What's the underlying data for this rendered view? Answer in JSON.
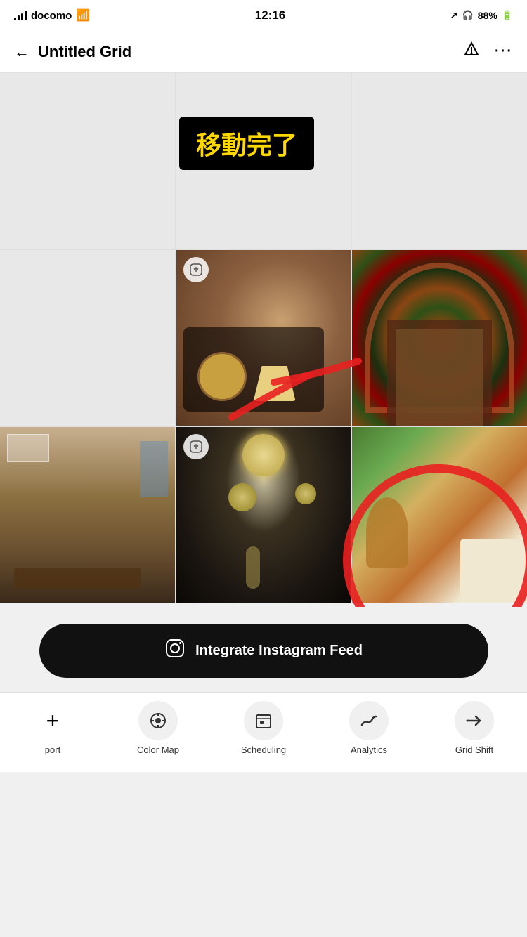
{
  "statusBar": {
    "carrier": "docomo",
    "time": "12:16",
    "battery": "88%",
    "signal": "full"
  },
  "header": {
    "title": "Untitled Grid",
    "backLabel": "←",
    "filterIcon": "filter",
    "moreIcon": "more"
  },
  "grid": {
    "rows": 3,
    "cols": 3,
    "cells": [
      {
        "id": "r1c1",
        "hasPhoto": false
      },
      {
        "id": "r1c2",
        "hasPhoto": false
      },
      {
        "id": "r1c3",
        "hasPhoto": false
      },
      {
        "id": "r2c1",
        "hasPhoto": false
      },
      {
        "id": "r2c2",
        "hasPhoto": true,
        "hasUpload": true
      },
      {
        "id": "r2c3",
        "hasPhoto": true
      },
      {
        "id": "r3c1",
        "hasPhoto": true
      },
      {
        "id": "r3c2",
        "hasPhoto": true,
        "hasUpload": true
      },
      {
        "id": "r3c3",
        "hasPhoto": true
      }
    ]
  },
  "annotation": {
    "label": "移動完了",
    "labelBg": "#000000",
    "labelColor": "#FFD700"
  },
  "instagramBtn": {
    "label": "Integrate Instagram Feed",
    "icon": "instagram"
  },
  "bottomNav": {
    "items": [
      {
        "id": "export",
        "label": "port",
        "icon": "+"
      },
      {
        "id": "colormap",
        "label": "Color Map",
        "icon": "👁"
      },
      {
        "id": "scheduling",
        "label": "Scheduling",
        "icon": "📅"
      },
      {
        "id": "analytics",
        "label": "Analytics",
        "icon": "〜"
      },
      {
        "id": "gridshift",
        "label": "Grid Shift",
        "icon": "→"
      }
    ]
  }
}
